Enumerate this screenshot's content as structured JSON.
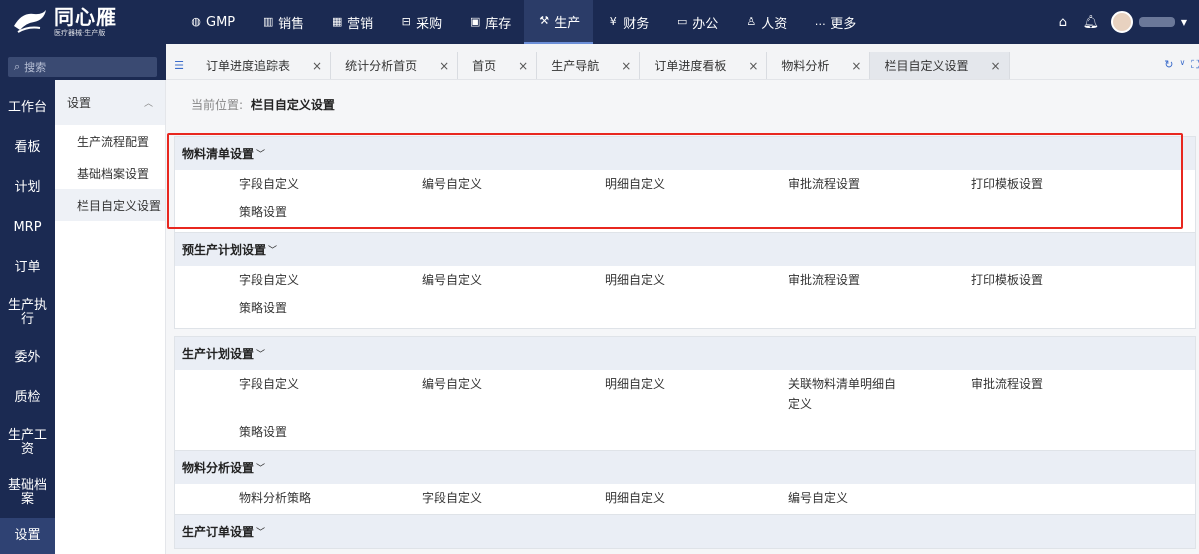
{
  "brand": {
    "title": "同心雁",
    "subtitle": "医疗器械·生产版"
  },
  "topnav": [
    {
      "icon": "gmp-icon",
      "glyph": "◍",
      "label": "GMP"
    },
    {
      "icon": "sales-icon",
      "glyph": "▥",
      "label": "销售"
    },
    {
      "icon": "marketing-icon",
      "glyph": "▦",
      "label": "营销"
    },
    {
      "icon": "purchase-icon",
      "glyph": "⊟",
      "label": "采购"
    },
    {
      "icon": "inventory-icon",
      "glyph": "▣",
      "label": "库存"
    },
    {
      "icon": "production-icon",
      "glyph": "⚒",
      "label": "生产"
    },
    {
      "icon": "finance-icon",
      "glyph": "¥",
      "label": "财务"
    },
    {
      "icon": "office-icon",
      "glyph": "▭",
      "label": "办公"
    },
    {
      "icon": "hr-icon",
      "glyph": "♙",
      "label": "人资"
    },
    {
      "icon": "more-icon",
      "glyph": "…",
      "label": "更多"
    }
  ],
  "topnav_active": "生产",
  "search": {
    "placeholder": "搜索"
  },
  "sidebar": [
    "工作台",
    "看板",
    "计划",
    "MRP",
    "订单",
    "生产执行",
    "委外",
    "质检",
    "生产工资",
    "基础档案",
    "设置"
  ],
  "submenu": {
    "head": "设置",
    "items": [
      "生产流程配置",
      "基础档案设置",
      "栏目自定义设置"
    ]
  },
  "tabs": [
    "订单进度追踪表",
    "统计分析首页",
    "首页",
    "生产导航",
    "订单进度看板",
    "物料分析",
    "栏目自定义设置"
  ],
  "breadcrumb": {
    "label": "当前位置:",
    "value": "栏目自定义设置"
  },
  "sections": [
    {
      "title": "物料清单设置",
      "rows": [
        [
          "字段自定义",
          "编号自定义",
          "明细自定义",
          "审批流程设置",
          "打印模板设置"
        ],
        [
          "策略设置"
        ]
      ]
    },
    {
      "title": "预生产计划设置",
      "rows": [
        [
          "字段自定义",
          "编号自定义",
          "明细自定义",
          "审批流程设置",
          "打印模板设置"
        ],
        [
          "策略设置"
        ]
      ]
    },
    {
      "title": "生产计划设置",
      "rows": [
        [
          "字段自定义",
          "编号自定义",
          "明细自定义",
          "关联物料清单明细自定义",
          "审批流程设置"
        ],
        [
          "策略设置"
        ]
      ]
    },
    {
      "title": "物料分析设置",
      "rows": [
        [
          "物料分析策略",
          "字段自定义",
          "明细自定义",
          "编号自定义"
        ]
      ]
    },
    {
      "title": "生产订单设置",
      "rows": []
    }
  ],
  "colors": {
    "nav_bg": "#1b2a52",
    "highlight": "#e8271f",
    "section_head": "#eaeef5"
  }
}
